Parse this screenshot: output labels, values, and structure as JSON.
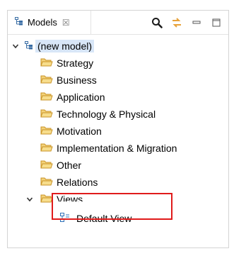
{
  "tab": {
    "title": "Models",
    "close_glyph": "☒"
  },
  "toolbar": {
    "search_icon": "search-icon",
    "link_icon": "link-with-editor-icon",
    "minimize_icon": "minimize-icon",
    "maximize_icon": "maximize-icon"
  },
  "tree": {
    "root": "(new model)",
    "folders": [
      "Strategy",
      "Business",
      "Application",
      "Technology & Physical",
      "Motivation",
      "Implementation & Migration",
      "Other",
      "Relations",
      "Views"
    ],
    "view_item": "Default View"
  },
  "colors": {
    "folder": "#e8b84a",
    "highlight": "#e01b1b",
    "selection": "#d8e6f7",
    "diagram_icon": "#2d6fb7"
  }
}
